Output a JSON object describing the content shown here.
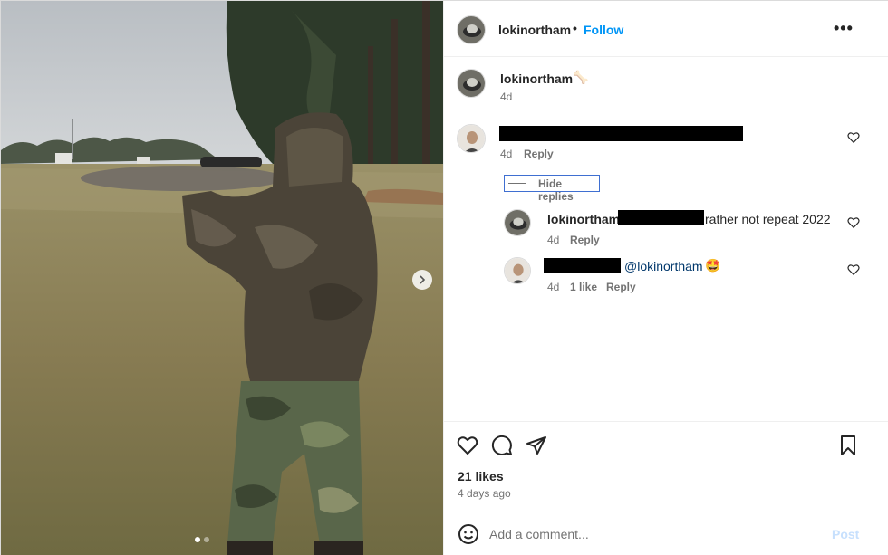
{
  "header": {
    "username": "lokinortham",
    "separator": "•",
    "follow_label": "Follow",
    "more_label": "•••"
  },
  "caption": {
    "username": "lokinortham",
    "emoji": "🦴",
    "time": "4d"
  },
  "comments": [
    {
      "time": "4d",
      "reply_label": "Reply",
      "hide_replies_label": "Hide replies",
      "replies": [
        {
          "username": "lokinortham",
          "text": "rather not repeat 2022",
          "time": "4d",
          "reply_label": "Reply"
        },
        {
          "mention": "@lokinortham",
          "emoji": "🤩",
          "time": "4d",
          "likes": "1 like",
          "reply_label": "Reply"
        }
      ]
    }
  ],
  "stats": {
    "likes": "21 likes",
    "date": "4 days ago"
  },
  "comment_input": {
    "placeholder": "Add a comment...",
    "post_label": "Post"
  },
  "colors": {
    "accent": "#0095f6",
    "muted": "#737373",
    "post_disabled": "#c7e0fd",
    "mention": "#00376b"
  },
  "icons": [
    "heart-icon",
    "comment-icon",
    "share-icon",
    "bookmark-icon",
    "emoji-icon",
    "chevron-right-icon",
    "more-icon"
  ]
}
